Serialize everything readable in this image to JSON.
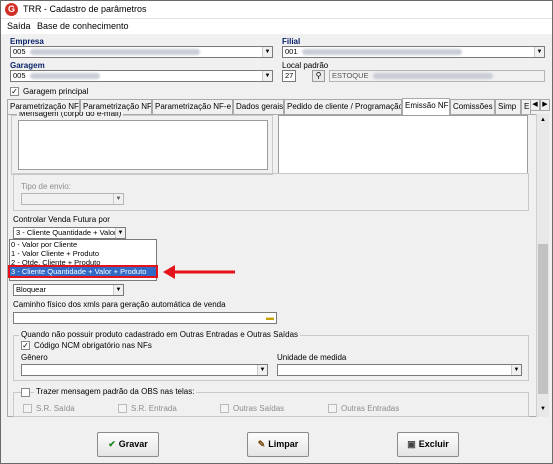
{
  "window": {
    "title": "TRR - Cadastro de parâmetros"
  },
  "menu": {
    "items": [
      "Saída",
      "Base de conhecimento"
    ]
  },
  "header": {
    "empresa_label": "Empresa",
    "empresa_code": "005",
    "filial_label": "Filial",
    "filial_code": "001",
    "garagem_label": "Garagem",
    "garagem_code": "005",
    "local_label": "Local padrão",
    "local_code": "27",
    "local_name": "ESTOQUE",
    "garagem_principal_label": "Garagem principal"
  },
  "tabs": [
    "Parametrização NF",
    "Parametrização NF",
    "Parametrização NF-e",
    "Dados gerais",
    "Pedido de cliente / Programação",
    "Emissão NF",
    "Comissões",
    "Simp",
    "E"
  ],
  "panel": {
    "mensagem_label": "Mensagem (corpo do e-mail)",
    "tipo_envio_label": "Tipo de envio:",
    "controlar_label": "Controlar Venda Futura por",
    "controlar_value": "3 - Cliente Quantidade + Valor",
    "options": [
      "0 - Valor por Cliente",
      "1 - Valor Cliente + Produto",
      "2 - Qtde. Cliente + Produto",
      "3 - Cliente Quantidade + Valor + Produto"
    ],
    "bloquear_value": "Bloquear",
    "caminho_label": "Caminho físico dos xmls para geração automática de venda",
    "outras_group_label": "Quando não possuir produto cadastrado em Outras Entradas e Outras Saídas",
    "ncm_label": "Código NCM obrigatório nas NFs",
    "genero_label": "Gênero",
    "unidade_label": "Unidade de medida",
    "obs_label": "Trazer mensagem padrão da OBS nas telas:",
    "obs_options": [
      "S.R. Saída",
      "S.R. Entrada",
      "Outras Saídas",
      "Outras Entradas"
    ]
  },
  "buttons": {
    "gravar": "Gravar",
    "limpar": "Limpar",
    "excluir": "Excluir"
  },
  "colors": {
    "highlight_arrow": "#e3121b",
    "selection": "#3169c6",
    "label_blue": "#0a246a"
  }
}
